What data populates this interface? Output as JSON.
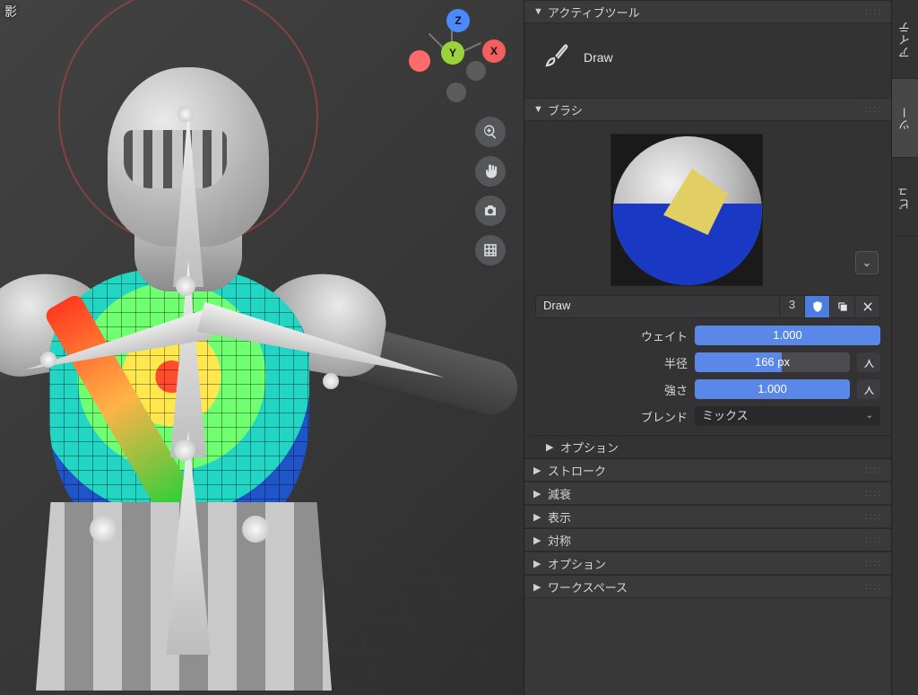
{
  "viewport": {
    "top_left_label": "影"
  },
  "gizmo": {
    "x": "X",
    "y": "Y",
    "z": "Z"
  },
  "panels": {
    "active_tool": {
      "title": "アクティブツール",
      "tool_name": "Draw"
    },
    "brush": {
      "title": "ブラシ",
      "name": "Draw",
      "users": "3",
      "fields": {
        "weight_label": "ウェイト",
        "weight_value": "1.000",
        "radius_label": "半径",
        "radius_value": "166 px",
        "strength_label": "強さ",
        "strength_value": "1.000",
        "blend_label": "ブレンド",
        "blend_value": "ミックス"
      },
      "sub_options": "オプション"
    },
    "collapsed": {
      "stroke": "ストローク",
      "falloff": "減衰",
      "display": "表示",
      "symmetry": "対称",
      "options": "オプション",
      "workspace": "ワークスペース"
    }
  },
  "tabs": {
    "item": "アイテ",
    "tool": "ツー",
    "view": "ビュ"
  }
}
